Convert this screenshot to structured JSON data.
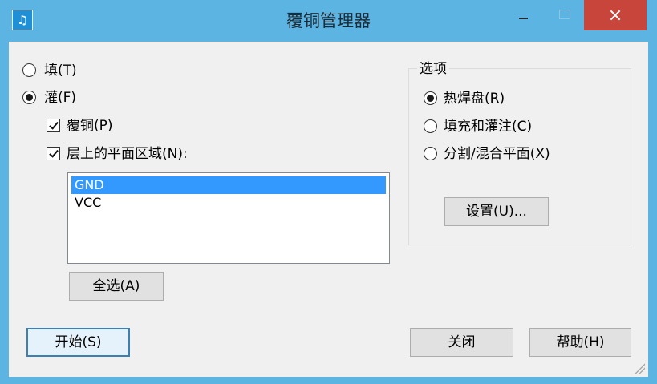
{
  "window": {
    "title": "覆铜管理器",
    "app_icon_glyph": "♫",
    "icons": {
      "minimize": "minimize-icon",
      "maximize": "maximize-icon",
      "close": "close-icon"
    }
  },
  "left": {
    "radio_fill": "填(T)",
    "radio_flood": "灌(F)",
    "radio_flood_selected": true,
    "check_copper": "覆铜(P)",
    "check_copper_checked": true,
    "check_plane": "层上的平面区域(N):",
    "check_plane_checked": true,
    "nets": [
      {
        "label": "GND",
        "selected": true
      },
      {
        "label": "VCC",
        "selected": false
      }
    ],
    "select_all": "全选(A)"
  },
  "options": {
    "group_title": "选项",
    "thermal": "热焊盘(R)",
    "thermal_selected": true,
    "fill_flood": "填充和灌注(C)",
    "split_mixed": "分割/混合平面(X)",
    "setup": "设置(U)..."
  },
  "footer": {
    "start": "开始(S)",
    "close": "关闭",
    "help": "帮助(H)"
  }
}
